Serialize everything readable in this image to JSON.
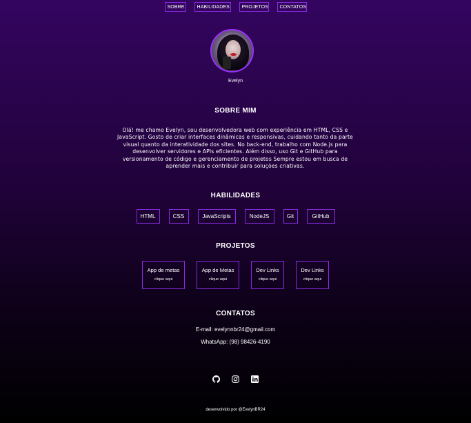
{
  "nav": {
    "items": [
      "SOBRE",
      "HABILIDADES",
      "PROJETOS",
      "CONTATOS"
    ]
  },
  "profile": {
    "name": "Evelyn"
  },
  "about": {
    "title": "SOBRE MIM",
    "text": "Olá! me chamo Evelyn, sou desenvolvedora web com experiência em HTML, CSS e JavaScript. Gosto de criar interfaces dinâmicas e responsivas, cuidando tanto da parte visual quanto da interatividade dos sites. No back-end, trabalho com Node.js para desenvolver servidores e APIs eficientes. Além disso, uso Git e GitHub para versionamento de código e gerenciamento de projetos Sempre estou em busca de aprender mais e contribuir para soluções criativas."
  },
  "skills": {
    "title": "HABILIDADES",
    "items": [
      "HTML",
      "CSS",
      "JavaScripts",
      "NodeJS",
      "Git",
      "GitHub"
    ]
  },
  "projects": {
    "title": "PROJETOS",
    "items": [
      {
        "title": "App de metas",
        "link": "clique aqui"
      },
      {
        "title": "App de Metas",
        "link": "clique aqui"
      },
      {
        "title": "Dev Links",
        "link": "clique aqui"
      },
      {
        "title": "Dev Links",
        "link": "clique aqui"
      }
    ]
  },
  "contacts": {
    "title": "CONTATOS",
    "email": "E-mail: evelynnbr24@gmail.com",
    "whatsapp": "WhatsApp: (98) 98426-4190"
  },
  "socials": [
    "github-icon",
    "instagram-icon",
    "linkedin-icon"
  ],
  "footer": {
    "text": "desenvolvido por @EvelynBR24"
  },
  "colors": {
    "accent": "#8a2be2",
    "background_top": "#340560",
    "background_bottom": "#000000"
  }
}
